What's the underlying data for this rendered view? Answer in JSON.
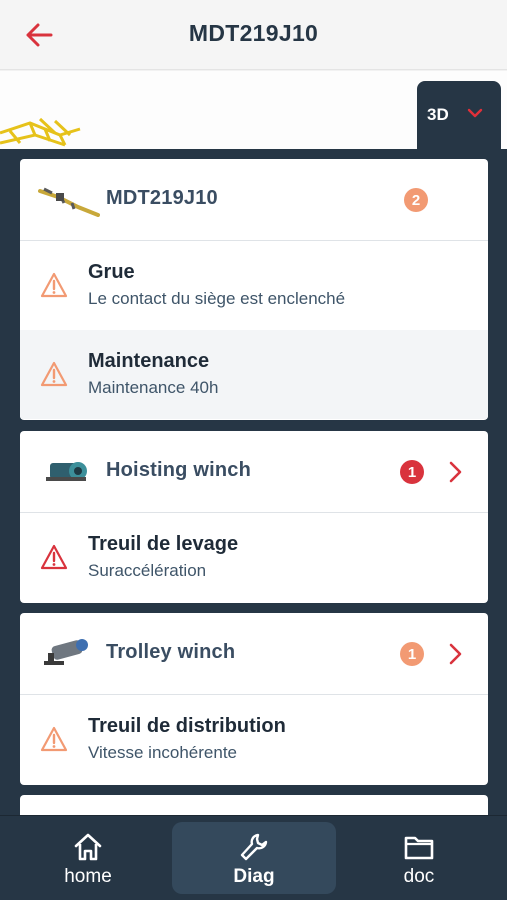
{
  "header": {
    "title": "MDT219J10",
    "back_icon": "arrow-left-icon"
  },
  "view_toggle": {
    "label": "3D",
    "icon": "chevron-down-icon"
  },
  "colors": {
    "accent": "#d9333d",
    "navy": "#263645",
    "warning": "#f29a73",
    "error": "#d9333d"
  },
  "cards": [
    {
      "title": "MDT219J10",
      "badge": "2",
      "badge_color": "orange",
      "alerts": [
        {
          "title": "Grue",
          "subtitle": "Le contact du siège est enclenché",
          "severity": "warning"
        },
        {
          "title": "Maintenance",
          "subtitle": "Maintenance 40h",
          "severity": "warning"
        }
      ]
    },
    {
      "title": "Hoisting winch",
      "badge": "1",
      "badge_color": "red",
      "alerts": [
        {
          "title": "Treuil de levage",
          "subtitle": "Suraccélération",
          "severity": "error"
        }
      ]
    },
    {
      "title": "Trolley winch",
      "badge": "1",
      "badge_color": "orange",
      "alerts": [
        {
          "title": "Treuil de distribution",
          "subtitle": "Vitesse incohérente",
          "severity": "warning"
        }
      ]
    }
  ],
  "nav": [
    {
      "label": "home",
      "icon": "home-icon"
    },
    {
      "label": "Diag",
      "icon": "wrench-icon",
      "active": true
    },
    {
      "label": "doc",
      "icon": "folder-icon"
    }
  ]
}
